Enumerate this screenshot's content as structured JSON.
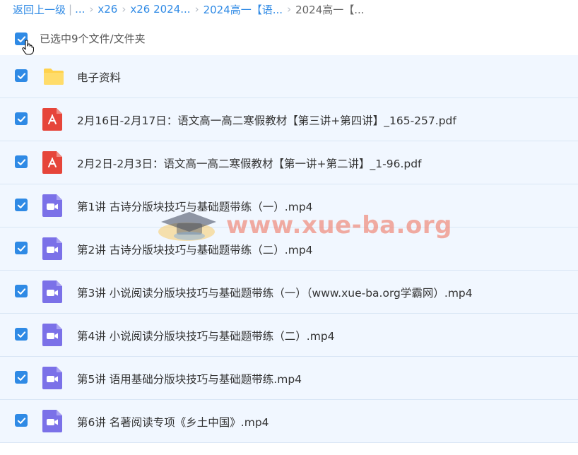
{
  "breadcrumb": {
    "back": "返回上一级",
    "sep1": "|",
    "ellipsis": "...",
    "items": [
      "x26",
      "x26 2024...",
      "2024高一【语..."
    ],
    "current": "2024高一【..."
  },
  "selection": {
    "text": "已选中9个文件/文件夹"
  },
  "files": [
    {
      "type": "folder",
      "icon": "folder-icon",
      "name": "电子资料"
    },
    {
      "type": "pdf",
      "icon": "pdf-icon",
      "name": "2月16日-2月17日：语文高一高二寒假教材【第三讲+第四讲】_165-257.pdf"
    },
    {
      "type": "pdf",
      "icon": "pdf-icon",
      "name": "2月2日-2月3日：语文高一高二寒假教材【第一讲+第二讲】_1-96.pdf"
    },
    {
      "type": "video",
      "icon": "video-icon",
      "name": "第1讲 古诗分版块技巧与基础题带练（一）.mp4"
    },
    {
      "type": "video",
      "icon": "video-icon",
      "name": "第2讲 古诗分版块技巧与基础题带练（二）.mp4"
    },
    {
      "type": "video",
      "icon": "video-icon",
      "name": "第3讲 小说阅读分版块技巧与基础题带练（一）（www.xue-ba.org学霸网）.mp4"
    },
    {
      "type": "video",
      "icon": "video-icon",
      "name": "第4讲 小说阅读分版块技巧与基础题带练（二）.mp4"
    },
    {
      "type": "video",
      "icon": "video-icon",
      "name": "第5讲 语用基础分版块技巧与基础题带练.mp4"
    },
    {
      "type": "video",
      "icon": "video-icon",
      "name": "第6讲 名著阅读专项《乡土中国》.mp4"
    }
  ],
  "watermark": {
    "text": "www.xue-ba.org"
  },
  "colors": {
    "accent": "#2f8ae5",
    "row_bg": "#f1f7ff",
    "folder": "#ffd24d",
    "pdf": "#e6453a",
    "video": "#7b71e8"
  }
}
